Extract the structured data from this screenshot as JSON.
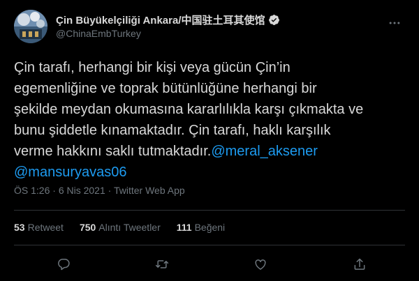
{
  "account": {
    "display_name": "Çin Büyükelçiliği Ankara/中国驻土耳其使馆",
    "handle": "@ChinaEmbTurkey",
    "verified": true
  },
  "tweet": {
    "lines": [
      "Çin tarafı, herhangi bir kişi veya gücün Çin’in",
      "egemenliğine ve toprak bütünlüğüne herhangi bir",
      "şekilde meydan okumasına kararlılıkla karşı çıkmakta ve",
      "bunu şiddetle kınamaktadır. Çin tarafı, haklı karşılık"
    ],
    "line5_text": "verme hakkını saklı tutmaktadır.",
    "mentions": [
      "@meral_aksener",
      "@mansuryavas06"
    ]
  },
  "meta": {
    "time": "ÖS 1:26",
    "separator": "·",
    "date": "6 Nis 2021",
    "source": "Twitter Web App"
  },
  "stats": [
    {
      "value": "53",
      "label": "Retweet"
    },
    {
      "value": "750",
      "label": "Alıntı Tweetler"
    },
    {
      "value": "111",
      "label": "Beğeni"
    }
  ],
  "actions": [
    "reply-icon",
    "retweet-icon",
    "like-icon",
    "share-icon"
  ],
  "colors": {
    "background": "#000000",
    "text": "#d9d9d9",
    "secondary": "#6e767d",
    "accent": "#1d9bf0",
    "divider": "#2f3336"
  }
}
